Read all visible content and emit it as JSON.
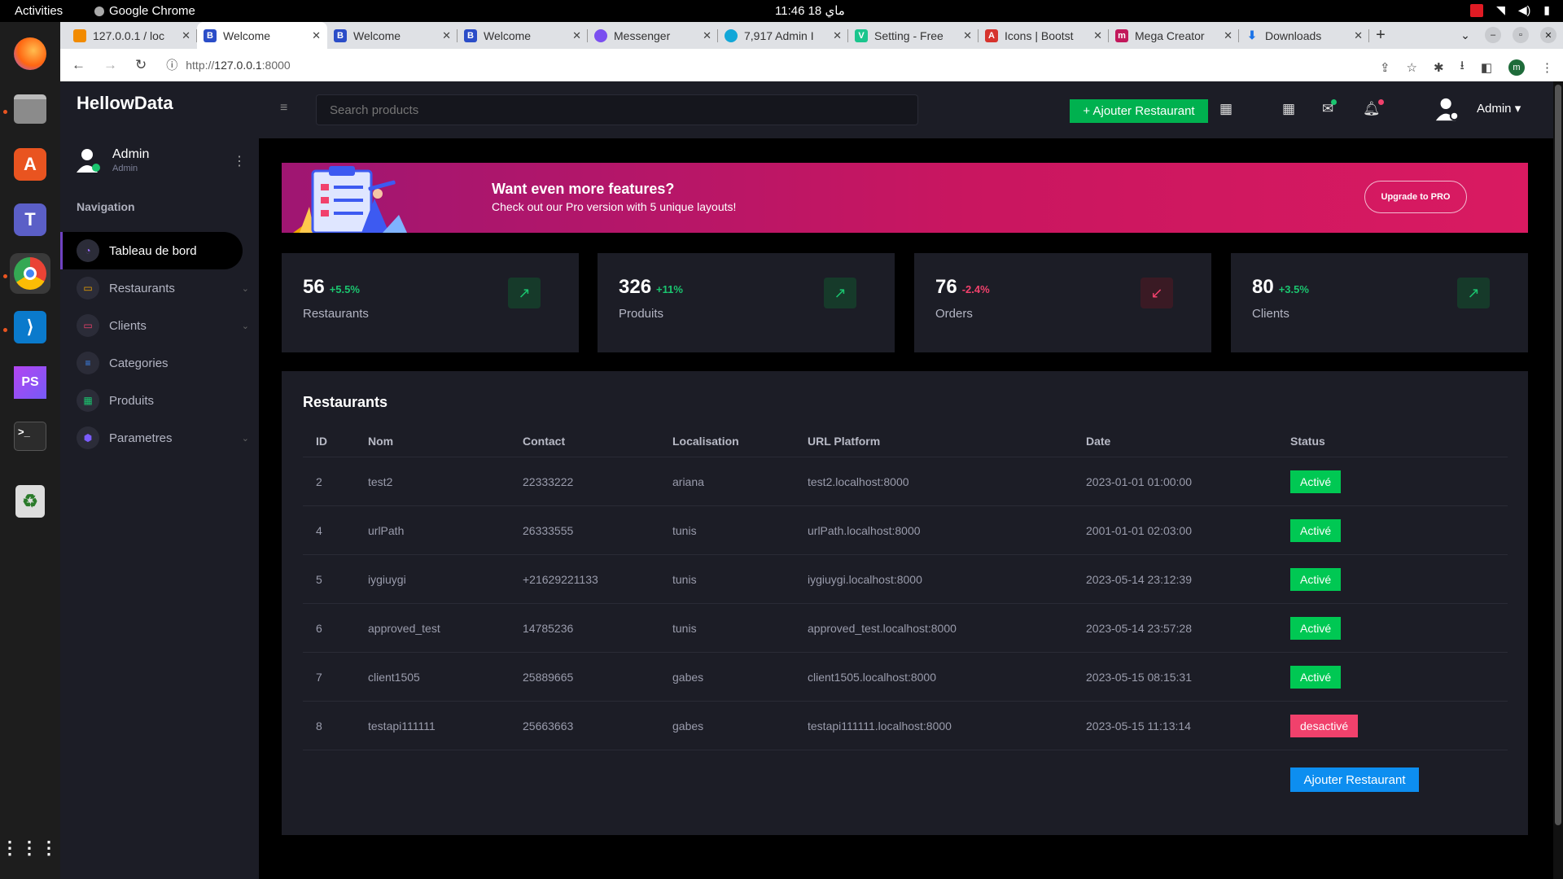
{
  "os": {
    "activities": "Activities",
    "app_name": "Google Chrome",
    "clock": "11:46  18 ماي"
  },
  "browser": {
    "tabs": [
      {
        "title": "127.0.0.1 / loc",
        "favicon_color": "#f28b00"
      },
      {
        "title": "Welcome",
        "favicon_color": "#2b4dc8"
      },
      {
        "title": "Welcome",
        "favicon_color": "#2b4dc8"
      },
      {
        "title": "Welcome",
        "favicon_color": "#2b4dc8"
      },
      {
        "title": "Messenger",
        "favicon_color": "#7b4ff0"
      },
      {
        "title": "7,917 Admin I",
        "favicon_color": "#12a7d8"
      },
      {
        "title": "Setting - Free",
        "favicon_color": "#1bc58d"
      },
      {
        "title": "Icons | Bootst",
        "favicon_color": "#d6332d"
      },
      {
        "title": "Mega Creator",
        "favicon_color": "#c2185b"
      },
      {
        "title": "Downloads",
        "favicon_color": "#1a73e8"
      }
    ],
    "url_prefix": "http://",
    "url_host": "127.0.0.1",
    "url_suffix": ":8000",
    "profile_initial": "m"
  },
  "app": {
    "brand": "HellowData",
    "user": {
      "name": "Admin",
      "role": "Admin"
    },
    "nav_label": "Navigation",
    "menu": [
      {
        "label": "Tableau de bord",
        "icon_color": "#9b6bff",
        "has_children": false
      },
      {
        "label": "Restaurants",
        "icon_color": "#f0a500",
        "has_children": true
      },
      {
        "label": "Clients",
        "icon_color": "#f1416c",
        "has_children": true
      },
      {
        "label": "Categories",
        "icon_color": "#3d8bfd",
        "has_children": false
      },
      {
        "label": "Produits",
        "icon_color": "#1bc56f",
        "has_children": false
      },
      {
        "label": "Parametres",
        "icon_color": "#7b5cff",
        "has_children": true
      }
    ],
    "search_placeholder": "Search products",
    "add_button": "+ Ajouter Restaurant",
    "header_user": "Admin"
  },
  "banner": {
    "title": "Want even more features?",
    "subtitle": "Check out our Pro version with 5 unique layouts!",
    "button": "Upgrade to PRO"
  },
  "stats": [
    {
      "value": "56",
      "change": "+5.5%",
      "label": "Restaurants",
      "trend": "up"
    },
    {
      "value": "326",
      "change": "+11%",
      "label": "Produits",
      "trend": "up"
    },
    {
      "value": "76",
      "change": "-2.4%",
      "label": "Orders",
      "trend": "down"
    },
    {
      "value": "80",
      "change": "+3.5%",
      "label": "Clients",
      "trend": "up"
    }
  ],
  "colors": {
    "up": "#1bc56f",
    "down": "#f1416c",
    "active": "#00c853",
    "inactive": "#f1416c"
  },
  "table": {
    "title": "Restaurants",
    "columns": [
      "ID",
      "Nom",
      "Contact",
      "Localisation",
      "URL Platform",
      "Date",
      "Status"
    ],
    "rows": [
      [
        "2",
        "test2",
        "22333222",
        "ariana",
        "test2.localhost:8000",
        "2023-01-01 01:00:00",
        "Activé"
      ],
      [
        "4",
        "urlPath",
        "26333555",
        "tunis",
        "urlPath.localhost:8000",
        "2001-01-01 02:03:00",
        "Activé"
      ],
      [
        "5",
        "iygiuygi",
        "+21629221133",
        "tunis",
        "iygiuygi.localhost:8000",
        "2023-05-14 23:12:39",
        "Activé"
      ],
      [
        "6",
        "approved_test",
        "14785236",
        "tunis",
        "approved_test.localhost:8000",
        "2023-05-14 23:57:28",
        "Activé"
      ],
      [
        "7",
        "client1505",
        "25889665",
        "gabes",
        "client1505.localhost:8000",
        "2023-05-15 08:15:31",
        "Activé"
      ],
      [
        "8",
        "testapi111111",
        "25663663",
        "gabes",
        "testapi111111.localhost:8000",
        "2023-05-15 11:13:14",
        "desactivé"
      ]
    ],
    "add_button": "Ajouter Restaurant"
  }
}
